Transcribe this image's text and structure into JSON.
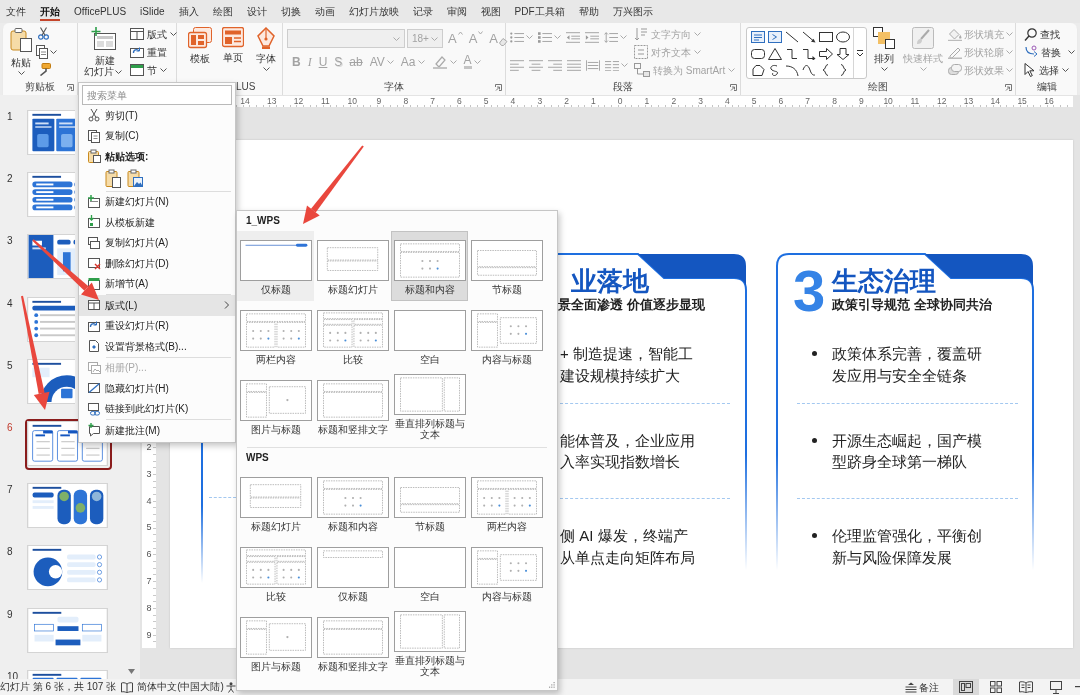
{
  "ribbon_tabs": [
    {
      "label": "文件",
      "selected": false
    },
    {
      "label": "开始",
      "selected": true
    },
    {
      "label": "OfficePLUS",
      "selected": false
    },
    {
      "label": "iSlide",
      "selected": false
    },
    {
      "label": "插入",
      "selected": false
    },
    {
      "label": "绘图",
      "selected": false
    },
    {
      "label": "设计",
      "selected": false
    },
    {
      "label": "切换",
      "selected": false
    },
    {
      "label": "动画",
      "selected": false
    },
    {
      "label": "幻灯片放映",
      "selected": false
    },
    {
      "label": "记录",
      "selected": false
    },
    {
      "label": "审阅",
      "selected": false
    },
    {
      "label": "视图",
      "selected": false
    },
    {
      "label": "PDF工具箱",
      "selected": false
    },
    {
      "label": "帮助",
      "selected": false
    },
    {
      "label": "万兴图示",
      "selected": false
    }
  ],
  "ribbon": {
    "clipboard": {
      "label": "剪贴板",
      "paste": "粘贴"
    },
    "slides": {
      "new_slide": "新建幻灯片",
      "layout": "版式",
      "reset": "重置",
      "section": "节"
    },
    "officeplus": {
      "label": "LUS",
      "buttons": [
        "模板",
        "单页",
        "字体"
      ]
    },
    "font": {
      "label": "字体",
      "disabled": true,
      "size": "18+",
      "grow": "A",
      "shrink": "A",
      "clear": "A",
      "buttons": [
        "B",
        "I",
        "U",
        "S",
        "ab",
        "AV",
        "Aa"
      ],
      "color_letter": "A"
    },
    "paragraph": {
      "label": "段落",
      "buttons": [
        {
          "label": "文字方向",
          "disabled": true
        },
        {
          "label": "对齐文本",
          "disabled": true
        },
        {
          "label": "转换为 SmartArt",
          "disabled": true
        }
      ]
    },
    "drawing": {
      "label": "绘图",
      "arrange": {
        "label": "排列",
        "disabled": false
      },
      "quick_styles": {
        "label": "快速样式",
        "disabled": true
      },
      "buttons": [
        {
          "label": "形状填充",
          "disabled": true
        },
        {
          "label": "形状轮廓",
          "disabled": true
        },
        {
          "label": "形状效果",
          "disabled": true
        }
      ]
    },
    "editing": {
      "label": "编辑",
      "buttons": [
        "查找",
        "替换",
        "选择"
      ]
    }
  },
  "slide_thumbnails": [
    {
      "number": "1",
      "selected": false
    },
    {
      "number": "2",
      "selected": false
    },
    {
      "number": "3",
      "selected": false
    },
    {
      "number": "4",
      "selected": false
    },
    {
      "number": "5",
      "selected": false
    },
    {
      "number": "6",
      "selected": true
    },
    {
      "number": "7",
      "selected": false
    },
    {
      "number": "8",
      "selected": false
    },
    {
      "number": "9",
      "selected": false
    },
    {
      "number": "10",
      "selected": false
    }
  ],
  "horizontal_ruler": {
    "labels": [
      "14",
      "13",
      "12",
      "11",
      "10",
      "9",
      "8",
      "7",
      "6",
      "5",
      "4",
      "3",
      "2",
      "1",
      "0",
      "1",
      "2",
      "3",
      "4",
      "5",
      "6",
      "7",
      "8",
      "9",
      "10",
      "11",
      "12",
      "13",
      "14",
      "15",
      "16"
    ]
  },
  "vertical_ruler": {
    "labels": [
      "2",
      "3",
      "4",
      "5",
      "6",
      "7",
      "8",
      "9"
    ]
  },
  "slide": {
    "cards": [
      {
        "kind": "covered",
        "title": "业落地",
        "subtitle": "景全面渗透 价值逐步显现",
        "bullets": [
          "+ 制造提速，智能工建设规模持续扩大",
          "能体普及，企业应用入率实现指数增长",
          "侧 AI 爆发，终端产从单点走向矩阵布局"
        ]
      },
      {
        "kind": "full",
        "number": "3",
        "title": "生态治理",
        "subtitle": "政策引导规范 全球协同共治",
        "bullets": [
          "政策体系完善，覆盖研发应用与安全全链条",
          "开源生态崛起，国产模型跻身全球第一梯队",
          "伦理监管强化，平衡创新与风险保障发展"
        ]
      }
    ]
  },
  "context_menu": {
    "search": {
      "placeholder": "搜索菜单"
    },
    "sections": [
      {
        "items": [
          {
            "kind": "item",
            "label": "剪切(T)",
            "selected": false,
            "disabled": false
          },
          {
            "kind": "item",
            "label": "复制(C)",
            "selected": false,
            "disabled": false
          },
          {
            "kind": "heading",
            "label": "粘贴选项:"
          },
          {
            "kind": "paste_options"
          }
        ]
      },
      {
        "items": [
          {
            "kind": "item",
            "label": "新建幻灯片(N)",
            "selected": false,
            "disabled": false
          },
          {
            "kind": "item",
            "label": "从模板新建",
            "selected": false,
            "disabled": false
          },
          {
            "kind": "item",
            "label": "复制幻灯片(A)",
            "selected": false,
            "disabled": false
          },
          {
            "kind": "item",
            "label": "删除幻灯片(D)",
            "selected": false,
            "disabled": false
          },
          {
            "kind": "item",
            "label": "新增节(A)",
            "selected": false,
            "disabled": false
          }
        ]
      },
      {
        "items": [
          {
            "kind": "submenu",
            "label": "版式(L)",
            "selected": true,
            "disabled": false
          },
          {
            "kind": "item",
            "label": "重设幻灯片(R)",
            "selected": false,
            "disabled": false
          },
          {
            "kind": "item",
            "label": "设置背景格式(B)...",
            "selected": false,
            "disabled": false
          }
        ]
      },
      {
        "items": [
          {
            "kind": "item",
            "label": "相册(P)...",
            "selected": false,
            "disabled": true
          },
          {
            "kind": "item",
            "label": "隐藏幻灯片(H)",
            "selected": false,
            "disabled": false
          },
          {
            "kind": "item",
            "label": "链接到此幻灯片(K)",
            "selected": false,
            "disabled": false
          }
        ]
      },
      {
        "items": [
          {
            "kind": "item",
            "label": "新建批注(M)",
            "selected": false,
            "disabled": false
          }
        ]
      }
    ]
  },
  "layout_menu": {
    "sets": [
      {
        "title": "1_WPS",
        "layouts": [
          {
            "label": "仅标题",
            "kind": "banner",
            "selected": false,
            "hovered": true
          },
          {
            "label": "标题幻灯片",
            "kind": "title_slide",
            "selected": false,
            "hovered": false
          },
          {
            "label": "标题和内容",
            "kind": "title_content",
            "selected": true,
            "hovered": false
          },
          {
            "label": "节标题",
            "kind": "section_header",
            "selected": false,
            "hovered": false
          },
          {
            "label": "两栏内容",
            "kind": "two_content",
            "selected": false,
            "hovered": false
          },
          {
            "label": "比较",
            "kind": "comparison",
            "selected": false,
            "hovered": false
          },
          {
            "label": "空白",
            "kind": "blank",
            "selected": false,
            "hovered": false
          },
          {
            "label": "内容与标题",
            "kind": "content_caption",
            "selected": false,
            "hovered": false
          },
          {
            "label": "图片与标题",
            "kind": "picture_caption",
            "selected": false,
            "hovered": false
          },
          {
            "label": "标题和竖排文字",
            "kind": "vertical_text",
            "selected": false,
            "hovered": false
          },
          {
            "label": "垂直排列标题与文本",
            "kind": "vertical_title",
            "selected": false,
            "hovered": false
          }
        ]
      },
      {
        "title": "WPS",
        "layouts": [
          {
            "label": "标题幻灯片",
            "kind": "title_slide",
            "selected": false,
            "hovered": false
          },
          {
            "label": "标题和内容",
            "kind": "title_content",
            "selected": false,
            "hovered": false
          },
          {
            "label": "节标题",
            "kind": "section_header",
            "selected": false,
            "hovered": false
          },
          {
            "label": "两栏内容",
            "kind": "two_content",
            "selected": false,
            "hovered": false
          },
          {
            "label": "比较",
            "kind": "comparison",
            "selected": false,
            "hovered": false
          },
          {
            "label": "仅标题",
            "kind": "title_only",
            "selected": false,
            "hovered": false
          },
          {
            "label": "空白",
            "kind": "blank",
            "selected": false,
            "hovered": false
          },
          {
            "label": "内容与标题",
            "kind": "content_caption",
            "selected": false,
            "hovered": false
          },
          {
            "label": "图片与标题",
            "kind": "picture_caption",
            "selected": false,
            "hovered": false
          },
          {
            "label": "标题和竖排文字",
            "kind": "vertical_text",
            "selected": false,
            "hovered": false
          },
          {
            "label": "垂直排列标题与文本",
            "kind": "vertical_title",
            "selected": false,
            "hovered": false
          }
        ]
      }
    ]
  },
  "status_bar": {
    "slide_info": "幻灯片 第 6 张，共 107 张",
    "language": "简体中文(中国大陆)",
    "notes": "备注",
    "views": [
      {
        "selected": true
      },
      {
        "selected": false
      },
      {
        "selected": false
      },
      {
        "selected": false
      }
    ]
  }
}
